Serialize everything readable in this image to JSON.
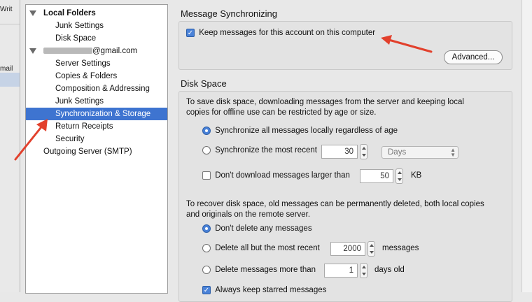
{
  "backdrop": {
    "frag_top": "Writ",
    "frag_mid": "mail"
  },
  "tree": {
    "items": [
      {
        "label": "Local Folders",
        "bold": true
      },
      {
        "label": "Junk Settings"
      },
      {
        "label": "Disk Space"
      },
      {
        "label": "@gmail.com"
      },
      {
        "label": "Server Settings"
      },
      {
        "label": "Copies & Folders"
      },
      {
        "label": "Composition & Addressing"
      },
      {
        "label": "Junk Settings"
      },
      {
        "label": "Synchronization & Storage",
        "selected": true
      },
      {
        "label": "Return Receipts"
      },
      {
        "label": "Security"
      },
      {
        "label": "Outgoing Server (SMTP)"
      }
    ]
  },
  "sync": {
    "title": "Message Synchronizing",
    "keep_label": "Keep messages for this account on this computer",
    "keep_checked": true,
    "advanced_button": "Advanced..."
  },
  "disk": {
    "title": "Disk Space",
    "intro_line1": "To save disk space, downloading messages from the server and keeping local",
    "intro_line2": "copies for offline use can be restricted by age or size.",
    "opt_all": "Synchronize all messages locally regardless of age",
    "opt_recent": "Synchronize the most recent",
    "recent_value": "30",
    "recent_unit": "Days",
    "opt_size": "Don't download messages larger than",
    "size_value": "50",
    "size_unit": "KB",
    "recover_line1": "To recover disk space, old messages can be permanently deleted, both local copies",
    "recover_line2": "and originals on the remote server.",
    "opt_dont_delete": "Don't delete any messages",
    "opt_delete_but": "Delete all but the most recent",
    "delete_but_value": "2000",
    "delete_but_unit": "messages",
    "opt_delete_older": "Delete messages more than",
    "delete_older_value": "1",
    "delete_older_unit": "days old",
    "opt_keep_starred": "Always keep starred messages"
  },
  "colors": {
    "selection": "#3e74d0",
    "annotation_arrow": "#e2402c"
  }
}
